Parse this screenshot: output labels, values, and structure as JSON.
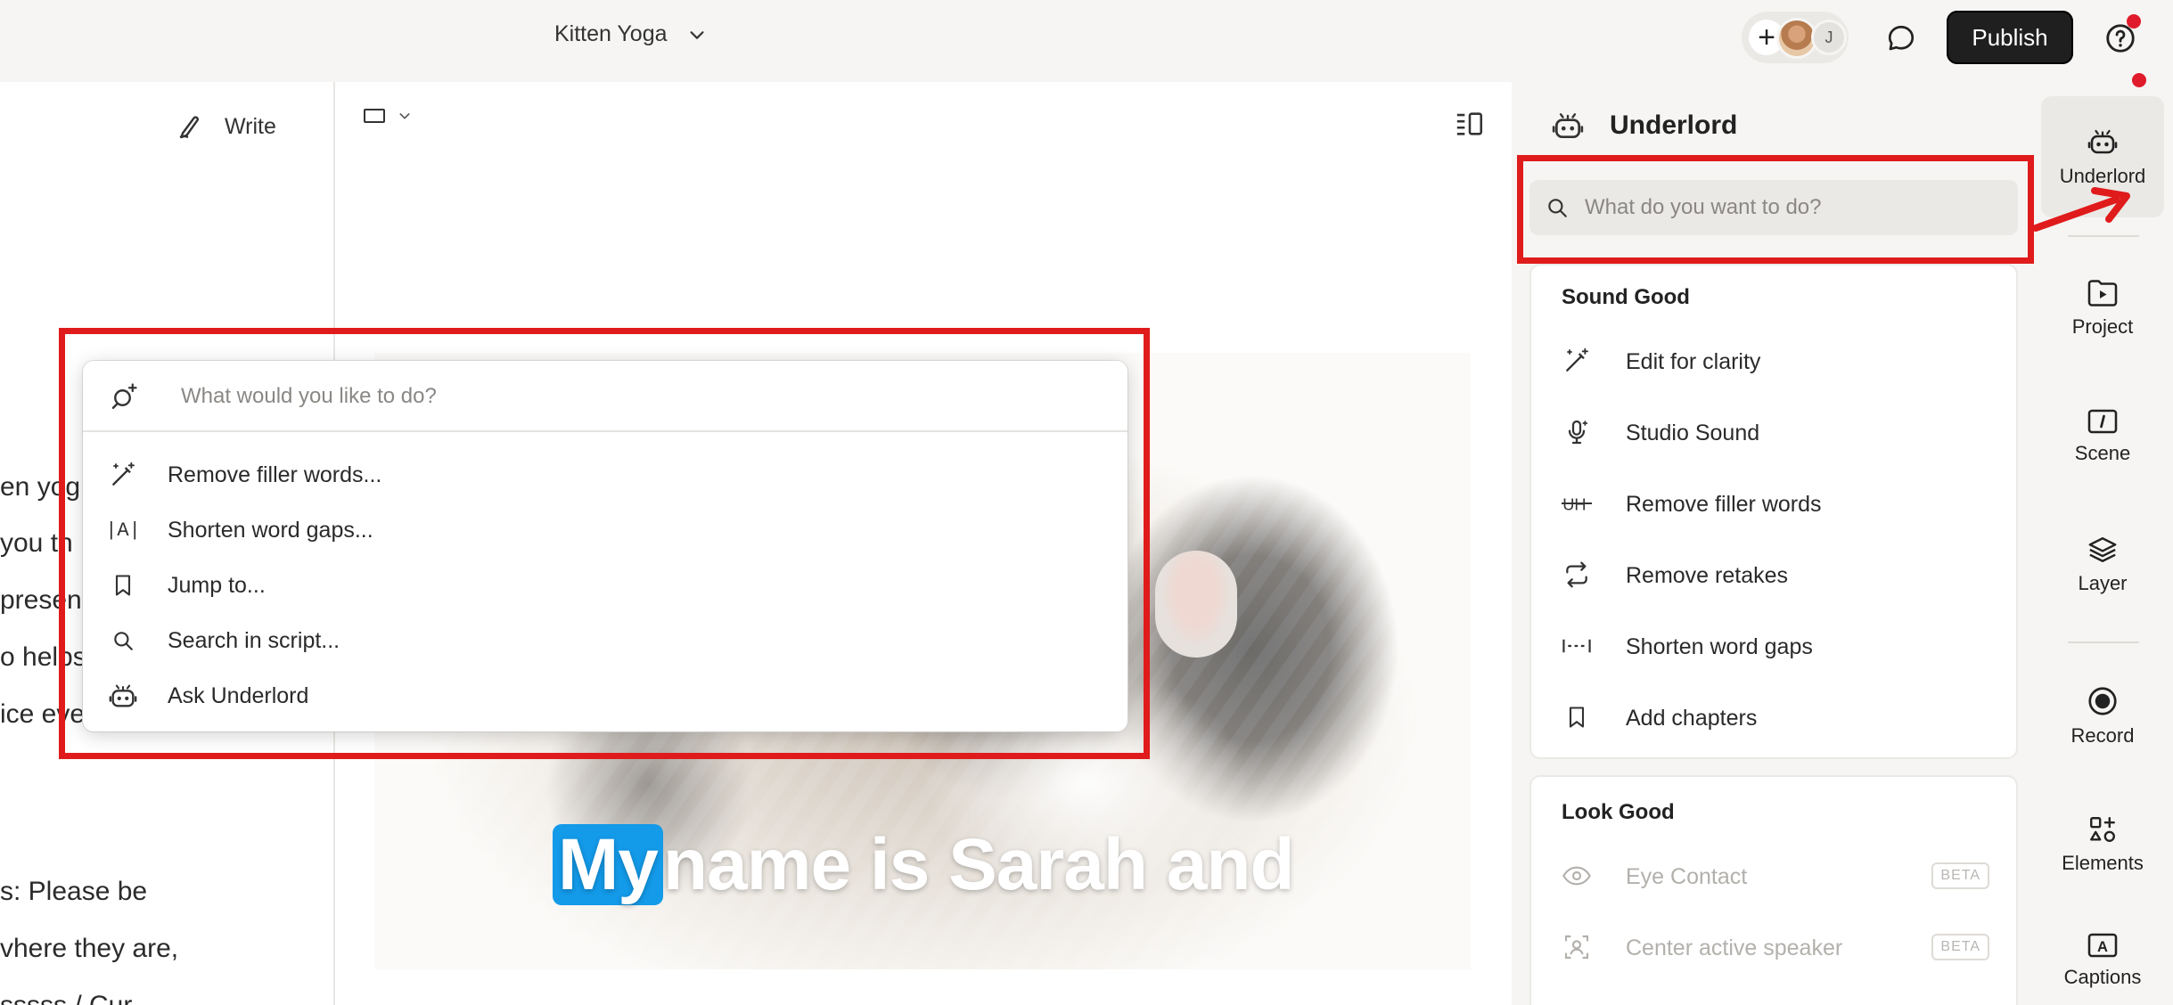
{
  "topbar": {
    "project_title": "Kitten Yoga",
    "collaborator_initial": "J",
    "publish_label": "Publish"
  },
  "script": {
    "write_label": "Write",
    "lines": [
      "en yog",
      "you th",
      "presen",
      "o helps",
      "ice eve",
      "s: Please be",
      "vhere they are,",
      "sssss / Cur"
    ]
  },
  "video": {
    "caption_highlight": "My",
    "caption_rest": "name is Sarah and"
  },
  "palette": {
    "placeholder": "What would you like to do?",
    "items": [
      {
        "label": "Remove filler words...",
        "icon": "magic-wand-icon"
      },
      {
        "label": "Shorten word gaps...",
        "icon": "word-gap-icon"
      },
      {
        "label": "Jump to...",
        "icon": "bookmark-icon"
      },
      {
        "label": "Search in script...",
        "icon": "search-icon"
      },
      {
        "label": "Ask Underlord",
        "icon": "robot-icon"
      }
    ]
  },
  "underlord": {
    "title": "Underlord",
    "search_placeholder": "What do you want to do?",
    "sound_good": {
      "title": "Sound Good",
      "items": [
        {
          "label": "Edit for clarity",
          "icon": "magic-wand-icon"
        },
        {
          "label": "Studio Sound",
          "icon": "studio-mic-icon"
        },
        {
          "label": "Remove filler words",
          "icon": "strikethrough-um-icon"
        },
        {
          "label": "Remove retakes",
          "icon": "repeat-icon"
        },
        {
          "label": "Shorten word gaps",
          "icon": "word-gap-icon"
        },
        {
          "label": "Add chapters",
          "icon": "bookmark-icon"
        }
      ]
    },
    "look_good": {
      "title": "Look Good",
      "items": [
        {
          "label": "Eye Contact",
          "badge": "BETA",
          "icon": "eye-icon"
        },
        {
          "label": "Center active speaker",
          "badge": "BETA",
          "icon": "focus-person-icon"
        }
      ]
    }
  },
  "rail": {
    "items": [
      {
        "label": "Underlord",
        "icon": "robot-icon"
      },
      {
        "label": "Project",
        "icon": "project-icon"
      },
      {
        "label": "Scene",
        "icon": "scene-icon"
      },
      {
        "label": "Layer",
        "icon": "layers-icon"
      },
      {
        "label": "Record",
        "icon": "record-icon"
      },
      {
        "label": "Elements",
        "icon": "elements-icon"
      },
      {
        "label": "Captions",
        "icon": "captions-icon"
      }
    ]
  },
  "colors": {
    "annotation_red": "#e01b1b",
    "caption_highlight": "#139ae9",
    "publish_bg": "#1f1f1f",
    "background": "#f6f5f3"
  }
}
